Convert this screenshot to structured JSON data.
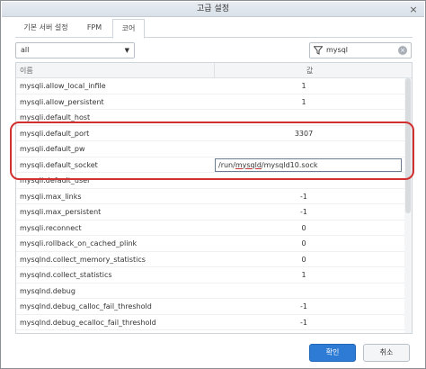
{
  "window": {
    "title": "고급 설정",
    "close_glyph": "×"
  },
  "tabs": [
    {
      "label": "기본 서버 설정"
    },
    {
      "label": "FPM"
    },
    {
      "label": "코어"
    }
  ],
  "filter": {
    "selected": "all",
    "arrow": "▼"
  },
  "search": {
    "value": "mysql",
    "clear_glyph": "×"
  },
  "grid": {
    "columns": [
      "이름",
      "값"
    ],
    "rows": [
      {
        "name": "mysqli.allow_local_infile",
        "value": "1"
      },
      {
        "name": "mysqli.allow_persistent",
        "value": "1"
      },
      {
        "name": "mysqli.default_host",
        "value": ""
      },
      {
        "name": "mysqli.default_port",
        "value": "3307"
      },
      {
        "name": "mysqli.default_pw",
        "value": ""
      },
      {
        "name": "mysqli.default_socket",
        "value": ""
      },
      {
        "name": "mysqli.default_user",
        "value": ""
      },
      {
        "name": "mysqli.max_links",
        "value": "-1"
      },
      {
        "name": "mysqli.max_persistent",
        "value": "-1"
      },
      {
        "name": "mysqli.reconnect",
        "value": "0"
      },
      {
        "name": "mysqli.rollback_on_cached_plink",
        "value": "0"
      },
      {
        "name": "mysqlnd.collect_memory_statistics",
        "value": "0"
      },
      {
        "name": "mysqlnd.collect_statistics",
        "value": "1"
      },
      {
        "name": "mysqlnd.debug",
        "value": ""
      },
      {
        "name": "mysqlnd.debug_calloc_fail_threshold",
        "value": "-1"
      },
      {
        "name": "mysqlnd.debug_ecalloc_fail_threshold",
        "value": "-1"
      }
    ],
    "editor": {
      "pre": "/run/",
      "underlined": "mysqld",
      "post": "/mysqld10.sock"
    }
  },
  "buttons": {
    "ok": "확인",
    "cancel": "취소"
  },
  "colors": {
    "accent": "#2d7bd4",
    "highlight": "#d2302f"
  }
}
